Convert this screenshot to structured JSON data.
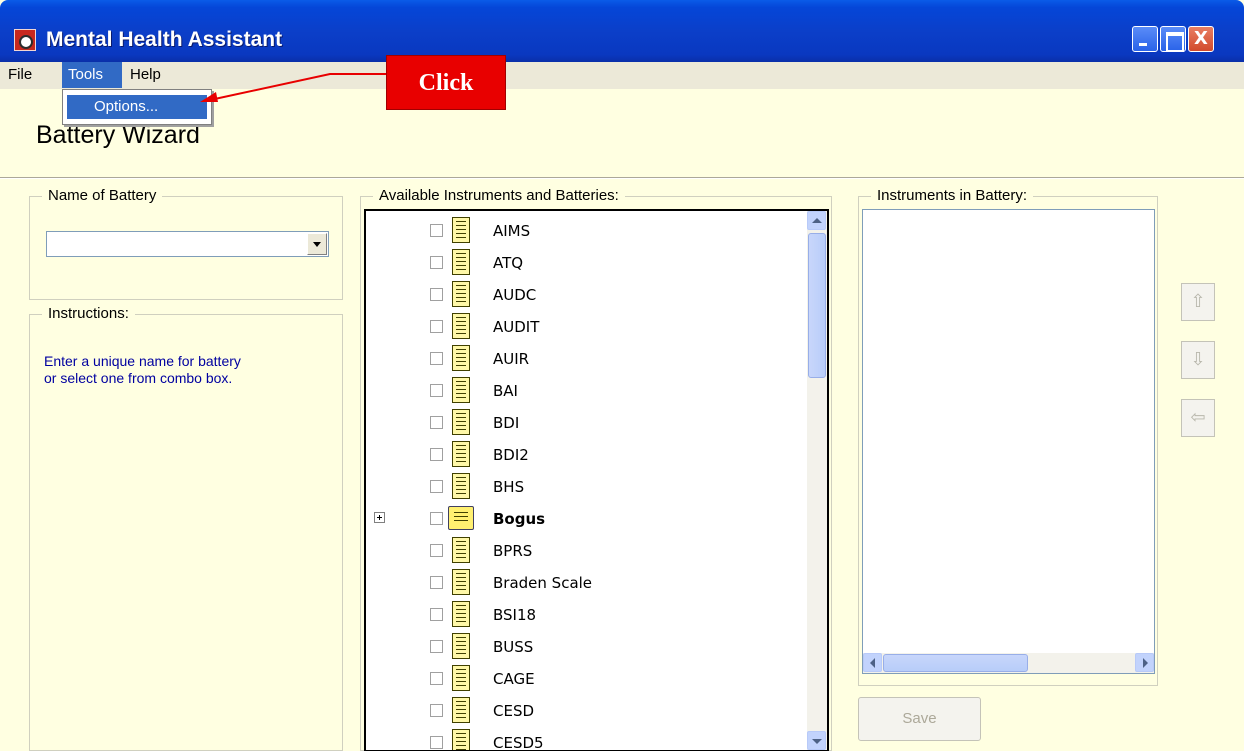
{
  "window": {
    "title": "Mental Health Assistant",
    "close_glyph": "X"
  },
  "menu": {
    "file": "File",
    "tools": "Tools",
    "help": "Help"
  },
  "dropdown": {
    "options": "Options..."
  },
  "callout": {
    "text": "Click"
  },
  "wizard": {
    "title": "Battery Wizard"
  },
  "name_group": {
    "legend": "Name of Battery",
    "combo_value": ""
  },
  "instructions_group": {
    "legend": "Instructions:",
    "text": "Enter a unique name for battery\nor select one from combo box."
  },
  "available_group": {
    "legend": "Available Instruments and Batteries:",
    "items": [
      {
        "label": "AIMS",
        "kind": "instrument"
      },
      {
        "label": "ATQ",
        "kind": "instrument"
      },
      {
        "label": "AUDC",
        "kind": "instrument"
      },
      {
        "label": "AUDIT",
        "kind": "instrument"
      },
      {
        "label": "AUIR",
        "kind": "instrument"
      },
      {
        "label": "BAI",
        "kind": "instrument"
      },
      {
        "label": "BDI",
        "kind": "instrument"
      },
      {
        "label": "BDI2",
        "kind": "instrument"
      },
      {
        "label": "BHS",
        "kind": "instrument"
      },
      {
        "label": "Bogus",
        "kind": "battery"
      },
      {
        "label": "BPRS",
        "kind": "instrument"
      },
      {
        "label": "Braden Scale",
        "kind": "instrument"
      },
      {
        "label": "BSI18",
        "kind": "instrument"
      },
      {
        "label": "BUSS",
        "kind": "instrument"
      },
      {
        "label": "CAGE",
        "kind": "instrument"
      },
      {
        "label": "CESD",
        "kind": "instrument"
      },
      {
        "label": "CESD5",
        "kind": "instrument"
      }
    ]
  },
  "battery_group": {
    "legend": "Instruments in Battery:"
  },
  "buttons": {
    "save": "Save"
  },
  "colors": {
    "titlebar": "#0A3FC9",
    "menu_highlight": "#316AC5",
    "callout": "#E80000",
    "panel_bg": "#FFFFE1",
    "instructions_text": "#0000A0"
  }
}
